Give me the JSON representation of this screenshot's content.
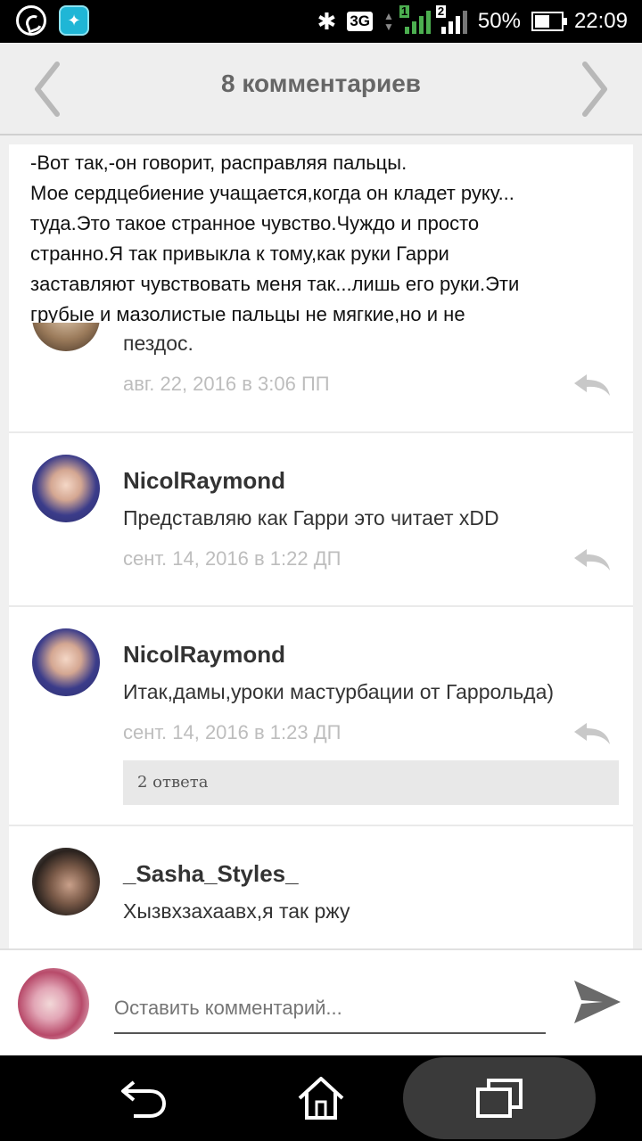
{
  "status": {
    "icons_left": [
      "whatsapp-icon",
      "runner-app-icon"
    ],
    "network": "3G",
    "sim1": "1",
    "sim2": "2",
    "battery": "50%",
    "time": "22:09"
  },
  "header": {
    "title": "8 комментариев"
  },
  "excerpt": {
    "lines": [
      "-Вот так,-он говорит, расправляя пальцы.",
      "Мое сердцебиение учащается,когда он кладет руку...",
      "туда.Это такое странное чувство.Чуждо и просто",
      "странно.Я так привыкла к тому,как руки Гарри",
      "заставляют чувствовать меня так...лишь его руки.Эти",
      "грубые и мазолистые пальцы не мягкие,но и не"
    ]
  },
  "comments": [
    {
      "name": "",
      "text": "пездос.",
      "date": "авг. 22, 2016 в 3:06 ПП",
      "replies": ""
    },
    {
      "name": "NicolRaymond",
      "text": "Представляю как Гарри это читает xDD",
      "date": "сент. 14, 2016 в 1:22 ДП",
      "replies": ""
    },
    {
      "name": "NicolRaymond",
      "text": "Итак,дамы,уроки мастурбации от Гаррольда)",
      "date": "сент. 14, 2016 в 1:23 ДП",
      "replies": "2 ответа"
    },
    {
      "name": "_Sasha_Styles_",
      "text": "Хызвхзахаавх,я так ржу",
      "date": "",
      "replies": ""
    }
  ],
  "compose": {
    "placeholder": "Оставить комментарий..."
  },
  "colors": {
    "header_bg": "#eeeeee",
    "title": "#666666",
    "date": "#bdbdbd",
    "reply_icon": "#c8c8c8"
  }
}
